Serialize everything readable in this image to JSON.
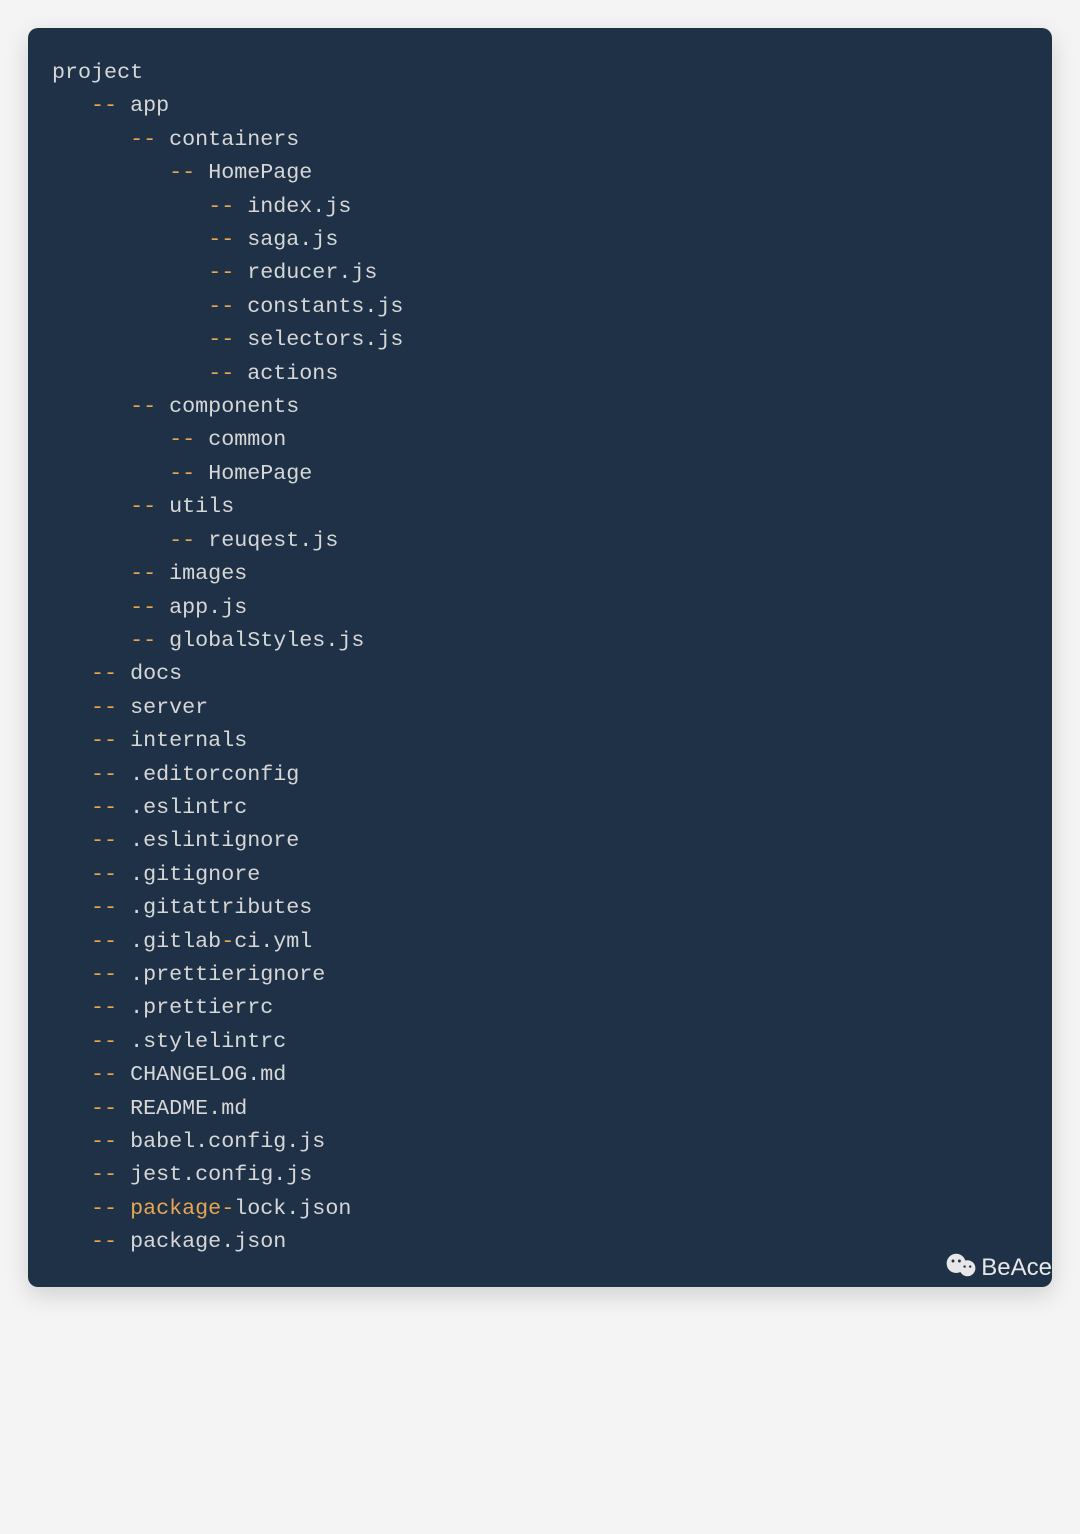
{
  "colors": {
    "background_page": "#f4f4f4",
    "background_card": "#1e3146",
    "text": "#d7d7d7",
    "accent": "#e9a651"
  },
  "indent_unit": "   ",
  "watermark": "BeAce",
  "tree": [
    {
      "depth": 0,
      "dash": false,
      "segments": [
        {
          "t": "project",
          "c": "plain"
        }
      ]
    },
    {
      "depth": 1,
      "dash": true,
      "segments": [
        {
          "t": "app",
          "c": "plain"
        }
      ]
    },
    {
      "depth": 2,
      "dash": true,
      "segments": [
        {
          "t": "containers",
          "c": "plain"
        }
      ]
    },
    {
      "depth": 3,
      "dash": true,
      "segments": [
        {
          "t": "HomePage",
          "c": "plain"
        }
      ]
    },
    {
      "depth": 4,
      "dash": true,
      "segments": [
        {
          "t": "index.js",
          "c": "plain"
        }
      ]
    },
    {
      "depth": 4,
      "dash": true,
      "segments": [
        {
          "t": "saga.js",
          "c": "plain"
        }
      ]
    },
    {
      "depth": 4,
      "dash": true,
      "segments": [
        {
          "t": "reducer.js",
          "c": "plain"
        }
      ]
    },
    {
      "depth": 4,
      "dash": true,
      "segments": [
        {
          "t": "constants.js",
          "c": "plain"
        }
      ]
    },
    {
      "depth": 4,
      "dash": true,
      "segments": [
        {
          "t": "selectors.js",
          "c": "plain"
        }
      ]
    },
    {
      "depth": 4,
      "dash": true,
      "segments": [
        {
          "t": "actions",
          "c": "plain"
        }
      ]
    },
    {
      "depth": 2,
      "dash": true,
      "segments": [
        {
          "t": "components",
          "c": "plain"
        }
      ]
    },
    {
      "depth": 3,
      "dash": true,
      "segments": [
        {
          "t": "common",
          "c": "plain"
        }
      ]
    },
    {
      "depth": 3,
      "dash": true,
      "segments": [
        {
          "t": "HomePage",
          "c": "plain"
        }
      ]
    },
    {
      "depth": 2,
      "dash": true,
      "segments": [
        {
          "t": "utils",
          "c": "plain"
        }
      ]
    },
    {
      "depth": 3,
      "dash": true,
      "segments": [
        {
          "t": "reuqest.js",
          "c": "plain"
        }
      ]
    },
    {
      "depth": 2,
      "dash": true,
      "segments": [
        {
          "t": "images",
          "c": "plain"
        }
      ]
    },
    {
      "depth": 2,
      "dash": true,
      "segments": [
        {
          "t": "app.js",
          "c": "plain"
        }
      ]
    },
    {
      "depth": 2,
      "dash": true,
      "segments": [
        {
          "t": "globalStyles.js",
          "c": "plain"
        }
      ]
    },
    {
      "depth": 1,
      "dash": true,
      "segments": [
        {
          "t": "docs",
          "c": "plain"
        }
      ]
    },
    {
      "depth": 1,
      "dash": true,
      "segments": [
        {
          "t": "server",
          "c": "plain"
        }
      ]
    },
    {
      "depth": 1,
      "dash": true,
      "segments": [
        {
          "t": "internals",
          "c": "plain"
        }
      ]
    },
    {
      "depth": 1,
      "dash": true,
      "segments": [
        {
          "t": ".editorconfig",
          "c": "plain"
        }
      ]
    },
    {
      "depth": 1,
      "dash": true,
      "segments": [
        {
          "t": ".eslintrc",
          "c": "plain"
        }
      ]
    },
    {
      "depth": 1,
      "dash": true,
      "segments": [
        {
          "t": ".eslintignore",
          "c": "plain"
        }
      ]
    },
    {
      "depth": 1,
      "dash": true,
      "segments": [
        {
          "t": ".gitignore",
          "c": "plain"
        }
      ]
    },
    {
      "depth": 1,
      "dash": true,
      "segments": [
        {
          "t": ".gitattributes",
          "c": "plain"
        }
      ]
    },
    {
      "depth": 1,
      "dash": true,
      "segments": [
        {
          "t": ".gitlab",
          "c": "plain"
        },
        {
          "t": "-",
          "c": "accent"
        },
        {
          "t": "ci.yml",
          "c": "plain"
        }
      ]
    },
    {
      "depth": 1,
      "dash": true,
      "segments": [
        {
          "t": ".prettierignore",
          "c": "plain"
        }
      ]
    },
    {
      "depth": 1,
      "dash": true,
      "segments": [
        {
          "t": ".prettierrc",
          "c": "plain"
        }
      ]
    },
    {
      "depth": 1,
      "dash": true,
      "segments": [
        {
          "t": ".stylelintrc",
          "c": "plain"
        }
      ]
    },
    {
      "depth": 1,
      "dash": true,
      "segments": [
        {
          "t": "CHANGELOG.md",
          "c": "plain"
        }
      ]
    },
    {
      "depth": 1,
      "dash": true,
      "segments": [
        {
          "t": "README.md",
          "c": "plain"
        }
      ]
    },
    {
      "depth": 1,
      "dash": true,
      "segments": [
        {
          "t": "babel.config.js",
          "c": "plain"
        }
      ]
    },
    {
      "depth": 1,
      "dash": true,
      "segments": [
        {
          "t": "jest.config.js",
          "c": "plain"
        }
      ]
    },
    {
      "depth": 1,
      "dash": true,
      "segments": [
        {
          "t": "package",
          "c": "accent"
        },
        {
          "t": "-",
          "c": "accent"
        },
        {
          "t": "lock.json",
          "c": "plain"
        }
      ]
    },
    {
      "depth": 1,
      "dash": true,
      "segments": [
        {
          "t": "package",
          "c": "plain"
        },
        {
          "t": ".json",
          "c": "plain"
        }
      ]
    }
  ]
}
